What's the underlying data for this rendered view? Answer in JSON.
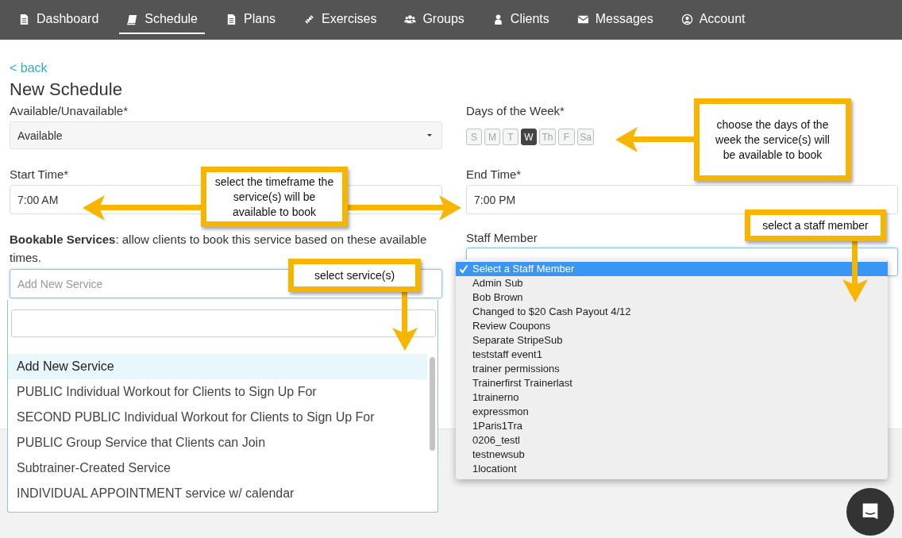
{
  "nav": [
    {
      "label": "Dashboard",
      "selected": false
    },
    {
      "label": "Schedule",
      "selected": true
    },
    {
      "label": "Plans",
      "selected": false
    },
    {
      "label": "Exercises",
      "selected": false
    },
    {
      "label": "Groups",
      "selected": false
    },
    {
      "label": "Clients",
      "selected": false
    },
    {
      "label": "Messages",
      "selected": false
    },
    {
      "label": "Account",
      "selected": false
    }
  ],
  "back_link": "< back",
  "title": "New Schedule",
  "availability": {
    "label": "Available/Unavailable*",
    "value": "Available"
  },
  "days": {
    "label": "Days of the Week*",
    "items": [
      {
        "label": "S",
        "selected": false
      },
      {
        "label": "M",
        "selected": false
      },
      {
        "label": "T",
        "selected": false
      },
      {
        "label": "W",
        "selected": true
      },
      {
        "label": "Th",
        "selected": false
      },
      {
        "label": "F",
        "selected": false
      },
      {
        "label": "Sa",
        "selected": false
      }
    ]
  },
  "start_time": {
    "label": "Start Time*",
    "value": "7:00 AM"
  },
  "end_time": {
    "label": "End Time*",
    "value": "7:00 PM"
  },
  "services": {
    "label": "**Bookable Services**: allow clients to book this service based on these available times.",
    "placeholder": "Add New Service",
    "options": [
      {
        "label": "Add New Service",
        "selected": true
      },
      {
        "label": "PUBLIC Individual Workout for Clients to Sign Up For",
        "selected": false
      },
      {
        "label": "SECOND PUBLIC Individual Workout for Clients to Sign Up For",
        "selected": false
      },
      {
        "label": "PUBLIC Group Service that Clients can Join",
        "selected": false
      },
      {
        "label": "Subtrainer-Created Service",
        "selected": false
      },
      {
        "label": "INDIVIDUAL APPOINTMENT service w/ calendar",
        "selected": false
      }
    ]
  },
  "staff": {
    "label": "Staff Member",
    "options": [
      {
        "label": "Select a Staff Member",
        "selected": true
      },
      {
        "label": "Admin Sub",
        "selected": false
      },
      {
        "label": "Bob Brown",
        "selected": false
      },
      {
        "label": "Changed to $20 Cash Payout 4/12",
        "selected": false
      },
      {
        "label": "Review Coupons",
        "selected": false
      },
      {
        "label": "Separate StripeSub",
        "selected": false
      },
      {
        "label": "teststaff event1",
        "selected": false
      },
      {
        "label": "trainer permissions",
        "selected": false
      },
      {
        "label": "Trainerfirst Trainerlast",
        "selected": false
      },
      {
        "label": "1trainerno",
        "selected": false
      },
      {
        "label": "expressmon",
        "selected": false
      },
      {
        "label": "1Paris1Tra",
        "selected": false
      },
      {
        "label": "0206_testl",
        "selected": false
      },
      {
        "label": "testnewsub",
        "selected": false
      },
      {
        "label": "1locationt",
        "selected": false
      }
    ]
  },
  "callouts": [
    {
      "text": "choose the days of the week the service(s) will be available to book"
    },
    {
      "text": "select the timeframe the service(s) will be available to book"
    },
    {
      "text": "select a staff member"
    },
    {
      "text": "select service(s)"
    }
  ]
}
